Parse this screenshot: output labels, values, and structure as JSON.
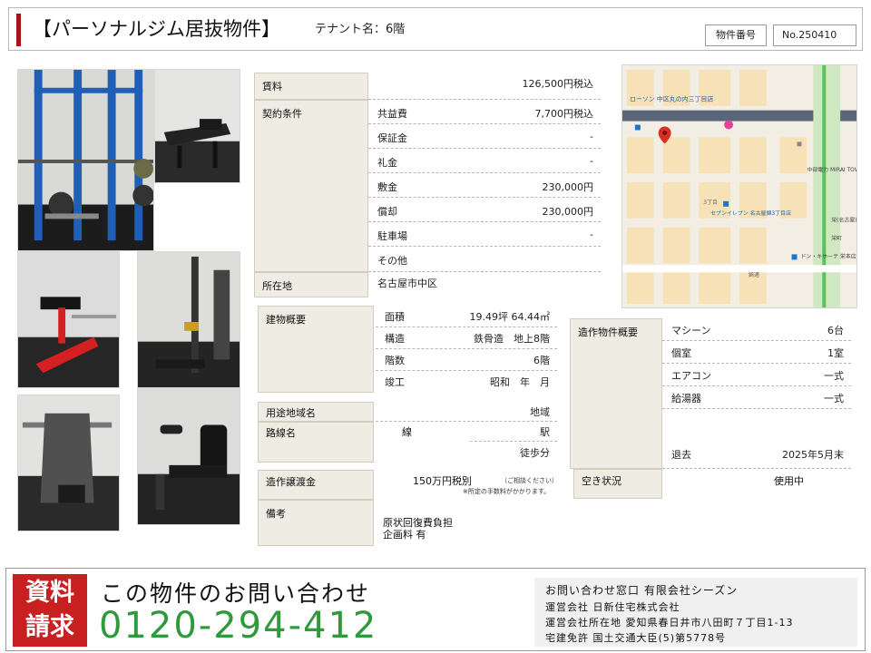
{
  "header": {
    "title": "【パーソナルジム居抜物件】",
    "subtitle": "テナント名：6階",
    "property_number_label": "物件番号",
    "property_number": "No.250410"
  },
  "rent": {
    "label": "賃料",
    "value": "126,500円税込"
  },
  "contract": {
    "label": "契約条件",
    "rows": [
      {
        "key": "共益費",
        "value": "7,700円税込"
      },
      {
        "key": "保証金",
        "value": "-"
      },
      {
        "key": "礼金",
        "value": "-"
      },
      {
        "key": "敷金",
        "value": "230,000円"
      },
      {
        "key": "償却",
        "value": "230,000円"
      },
      {
        "key": "駐車場",
        "value": "-"
      },
      {
        "key": "その他",
        "value": ""
      }
    ]
  },
  "location": {
    "label": "所在地",
    "value": "名古屋市中区"
  },
  "building": {
    "label": "建物概要",
    "area_key": "面積",
    "area_value": "19.49坪 64.44㎡",
    "structure_key": "構造",
    "structure_value": "鉄骨造　地上8階",
    "floor_key": "階数",
    "floor_value": "6階",
    "built_key": "竣工",
    "built_value": "昭和　年　月"
  },
  "zoning": {
    "label": "用途地域名",
    "value": "地域"
  },
  "route": {
    "label": "路線名",
    "line": "線",
    "station": "駅",
    "walk": "徒歩分"
  },
  "transfer_fee": {
    "label": "造作譲渡金",
    "value": "150万円税別",
    "note1": "（ご相談ください）",
    "note2": "※所定の手数料がかかります。"
  },
  "remarks": {
    "label": "備考",
    "line1": "原状回復費負担",
    "line2": "企画料 有"
  },
  "fixtures": {
    "label": "造作物件概要",
    "rows": [
      {
        "key": "マシーン",
        "value": "6台"
      },
      {
        "key": "個室",
        "value": "1室"
      },
      {
        "key": "エアコン",
        "value": "一式"
      },
      {
        "key": "給湯器",
        "value": "一式"
      }
    ],
    "leave_key": "退去",
    "leave_value": "2025年5月末"
  },
  "vacancy": {
    "label": "空き状況",
    "value": "使用中"
  },
  "map_labels": {
    "store1": "ローソン 中区丸の内三丁目店",
    "tower": "中部電力 MIRAI TOWER",
    "store2": "セブンイレブン 名古屋錦3丁目店",
    "station1": "栄(名古屋)",
    "station2": "栄町",
    "store3": "ドン・キホーテ 栄本店",
    "road": "3丁目",
    "road2": "錦通"
  },
  "footer": {
    "badge_line1": "資料",
    "badge_line2": "請求",
    "inquiry": "この物件のお問い合わせ",
    "phone": "0120-294-412",
    "info1": "お問い合わせ窓口 有限会社シーズン",
    "info2": "運営会社 日新住宅株式会社",
    "info3": "運営会社所在地 愛知県春日井市八田町７丁目1-13",
    "info4": "宅建免許 国土交通大臣(5)第5778号"
  },
  "colors": {
    "accent": "#a31515",
    "phone": "#2f9a3a",
    "badge": "#c82020",
    "label_bg": "#efece3"
  }
}
